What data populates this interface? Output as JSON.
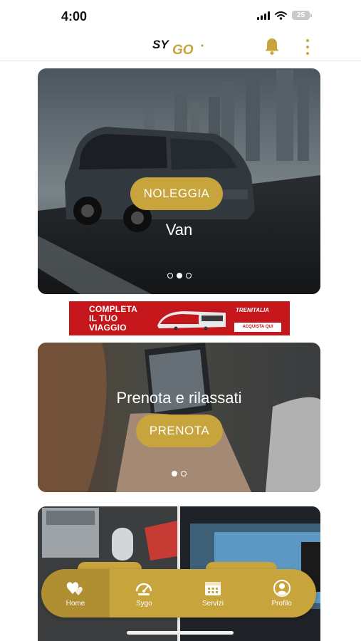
{
  "status_bar": {
    "time": "4:00",
    "battery": "25"
  },
  "header": {
    "logo_text": "SYGO"
  },
  "hero_card": {
    "title": "Van",
    "button_label": "NOLEGGIA",
    "slides": 3,
    "active_slide": 2
  },
  "banner": {
    "line1": "COMPLETA",
    "line2": "IL TUO",
    "line3": "VIAGGIO",
    "brand": "TRENITALIA",
    "cta": "ACQUISTA QUI"
  },
  "prenota_card": {
    "title": "Prenota e rilassati",
    "button_label": "PRENOTA",
    "slides": 2,
    "active_slide": 1
  },
  "bottom_nav": {
    "items": [
      {
        "label": "Home",
        "icon": "hearts-icon"
      },
      {
        "label": "Sygo",
        "icon": "sygo-gauge-icon"
      },
      {
        "label": "Servizi",
        "icon": "calendar-icon"
      },
      {
        "label": "Profilo",
        "icon": "person-icon"
      }
    ],
    "active": "Home"
  },
  "colors": {
    "accent": "#c8a43d",
    "banner_red": "#c5161c"
  }
}
